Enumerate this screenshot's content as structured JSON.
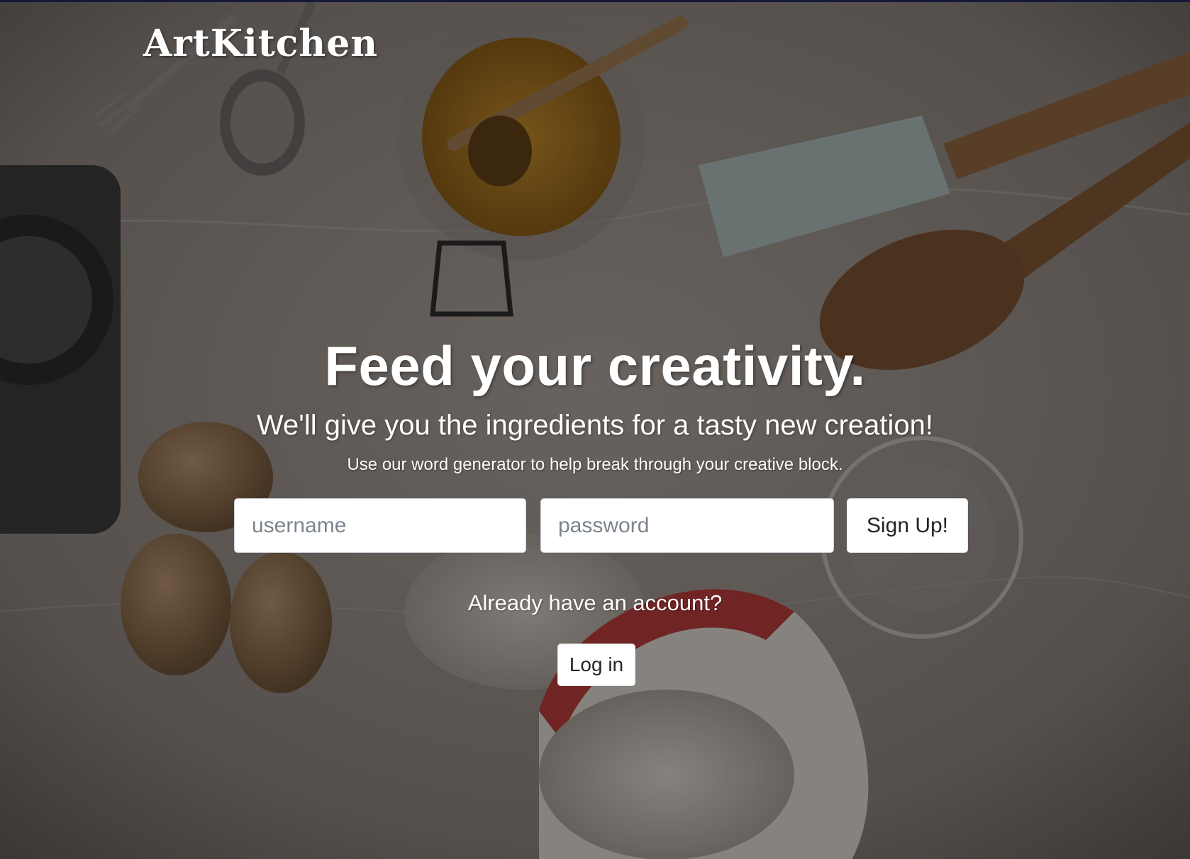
{
  "brand": {
    "name": "ArtKitchen"
  },
  "hero": {
    "title": "Feed your creativity.",
    "subtitle": "We'll give you the ingredients for a tasty new creation!",
    "caption": "Use our word generator to help break through your creative block."
  },
  "signup": {
    "username_placeholder": "username",
    "username_value": "",
    "password_placeholder": "password",
    "password_value": "",
    "submit_label": "Sign Up!"
  },
  "login": {
    "prompt": "Already have an account?",
    "button_label": "Log in"
  },
  "colors": {
    "overlay": "#000000",
    "text": "#ffffff",
    "button_bg": "#ffffff",
    "button_text": "#212529",
    "top_border": "#16183a"
  },
  "background": {
    "description_icon": "kitchen-tabletop-photo-icon"
  }
}
